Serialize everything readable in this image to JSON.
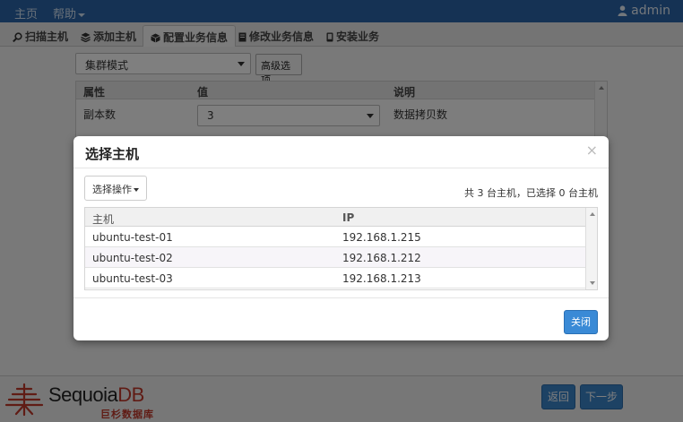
{
  "topnav": {
    "home": "主页",
    "help": "帮助",
    "user": "admin"
  },
  "tabs": [
    {
      "label": "扫描主机",
      "icon": "search-icon"
    },
    {
      "label": "添加主机",
      "icon": "stack-icon"
    },
    {
      "label": "配置业务信息",
      "icon": "cube-icon"
    },
    {
      "label": "修改业务信息",
      "icon": "document-icon"
    },
    {
      "label": "安装业务",
      "icon": "phone-icon"
    }
  ],
  "config": {
    "mode_value": "集群模式",
    "advanced_label": "高级选项",
    "table_headers": {
      "attr": "属性",
      "value": "值",
      "desc": "说明"
    },
    "row": {
      "attr": "副本数",
      "value": "3",
      "desc": "数据拷贝数"
    }
  },
  "modal": {
    "title": "选择主机",
    "close_glyph": "×",
    "ops_label": "选择操作",
    "summary": "共 3 台主机，已选择 0 台主机",
    "headers": {
      "host": "主机",
      "ip": "IP"
    },
    "rows": [
      {
        "host": "ubuntu-test-01",
        "ip": "192.168.1.215"
      },
      {
        "host": "ubuntu-test-02",
        "ip": "192.168.1.212"
      },
      {
        "host": "ubuntu-test-03",
        "ip": "192.168.1.213"
      }
    ],
    "close_button": "关闭"
  },
  "footer": {
    "logo_main": "Sequoia",
    "logo_db": "DB",
    "logo_sub": "巨杉数据库",
    "back_button": "返回",
    "next_button": "下一步"
  },
  "colors": {
    "nav_bg": "#2b64a8",
    "primary_button": "#3a8ad6",
    "logo_red": "#c0392b"
  }
}
